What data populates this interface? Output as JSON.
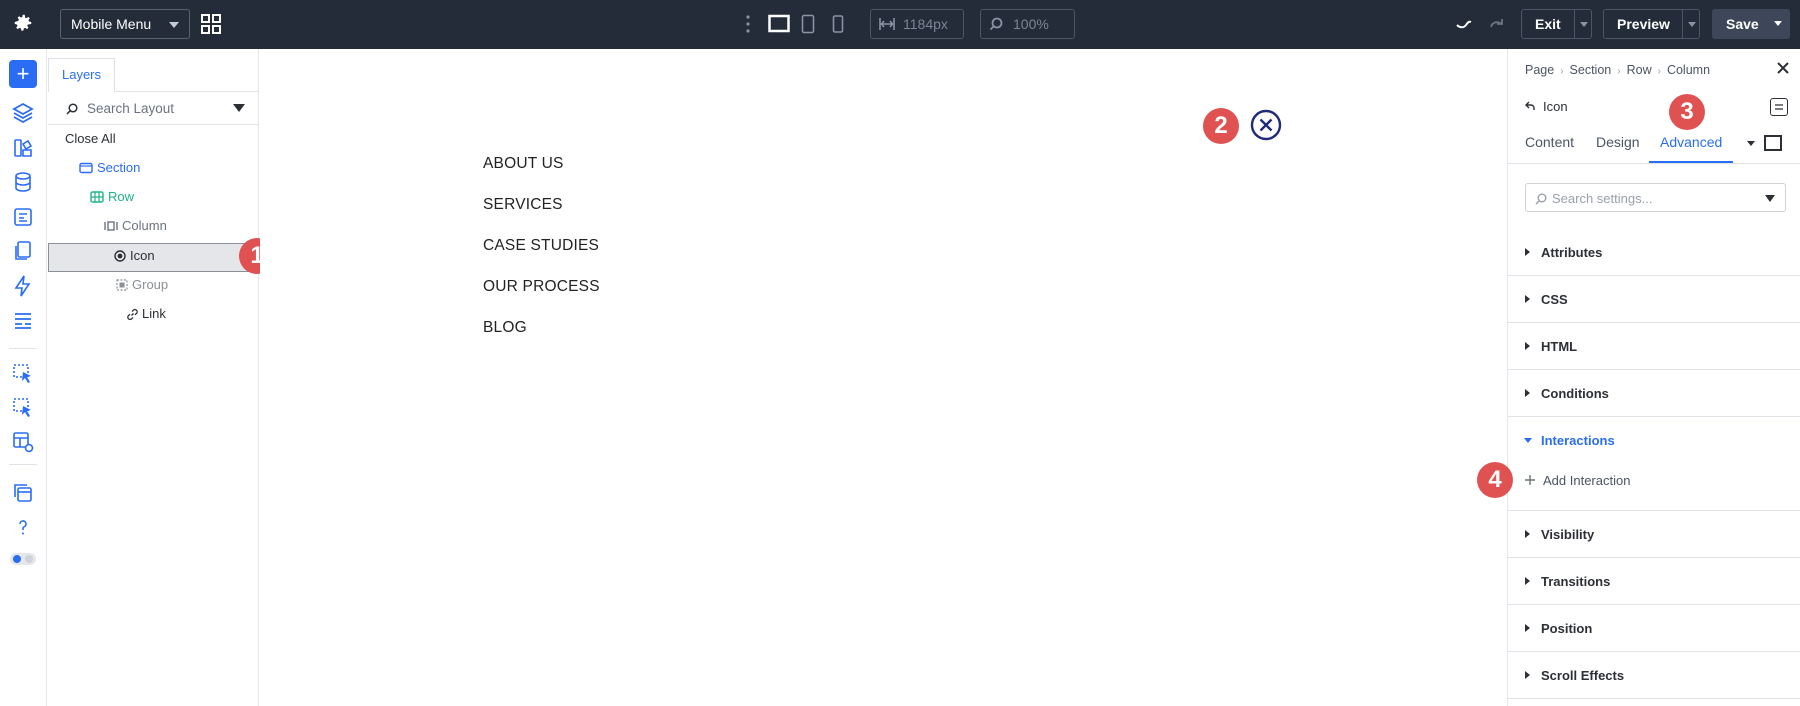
{
  "topbar": {
    "mode_dropdown": "Mobile Menu",
    "width_value": "1184px",
    "zoom_value": "100%",
    "exit_label": "Exit",
    "preview_label": "Preview",
    "save_label": "Save"
  },
  "layers": {
    "tab_label": "Layers",
    "search_placeholder": "Search Layout",
    "close_all": "Close All",
    "tree": [
      {
        "label": "Section",
        "color": "#2a6df4"
      },
      {
        "label": "Row",
        "color": "#1fb489"
      },
      {
        "label": "Column",
        "color": "#6b7280"
      },
      {
        "label": "Icon",
        "color": "#2c2f35",
        "selected": true
      },
      {
        "label": "Group",
        "color": "#8b8f97"
      },
      {
        "label": "Link",
        "color": "#2c2f35"
      }
    ]
  },
  "canvas": {
    "menu_items": [
      "ABOUT US",
      "SERVICES",
      "CASE STUDIES",
      "OUR PROCESS",
      "BLOG"
    ]
  },
  "badges": [
    "1",
    "2",
    "3",
    "4"
  ],
  "panel": {
    "breadcrumb": [
      "Page",
      "Section",
      "Row",
      "Column"
    ],
    "module_title": "Icon",
    "tabs": [
      "Content",
      "Design",
      "Advanced"
    ],
    "active_tab": "Advanced",
    "search_placeholder": "Search settings...",
    "sections": [
      "Attributes",
      "CSS",
      "HTML",
      "Conditions",
      "Interactions",
      "Visibility",
      "Transitions",
      "Position",
      "Scroll Effects"
    ],
    "expanded_section": "Interactions",
    "add_interaction": "Add Interaction"
  },
  "colors": {
    "accent": "#2a6df4",
    "topbar": "#242b39",
    "badge": "#e05252"
  }
}
